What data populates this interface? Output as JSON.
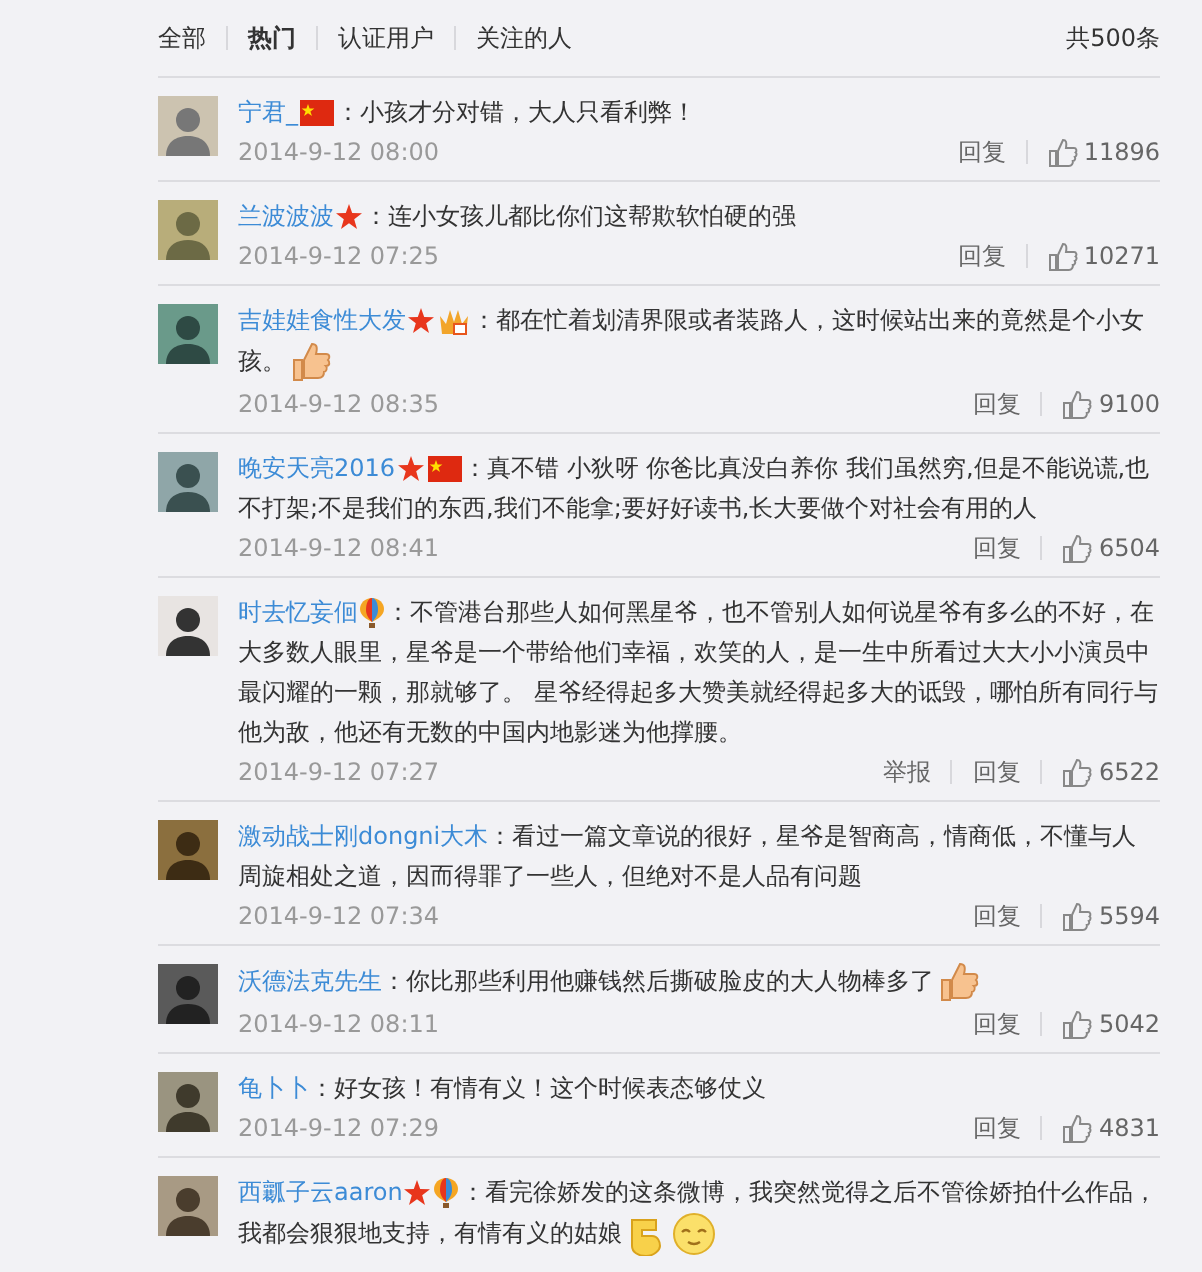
{
  "tabs": [
    {
      "label": "全部",
      "selected": false
    },
    {
      "label": "热门",
      "selected": true
    },
    {
      "label": "认证用户",
      "selected": false
    },
    {
      "label": "关注的人",
      "selected": false
    }
  ],
  "total": "共500条",
  "comments": [
    {
      "user": "宁君_",
      "badges": [
        {
          "kind": "flag"
        }
      ],
      "text": "：小孩才分对错，大人只看利弊！",
      "time": "2014-9-12 08:00",
      "actions": [
        "回复"
      ],
      "likes": "11896"
    },
    {
      "user": "兰波波波",
      "badges": [
        {
          "kind": "star"
        }
      ],
      "text": "：连小女孩儿都比你们这帮欺软怕硬的强",
      "time": "2014-9-12 07:25",
      "actions": [
        "回复"
      ],
      "likes": "10271"
    },
    {
      "user": "吉娃娃食性大发",
      "badges": [
        {
          "kind": "star"
        },
        {
          "kind": "crown"
        }
      ],
      "text": "：都在忙着划清界限或者装路人，这时候站出来的竟然是个小女孩。",
      "emojis": [
        {
          "kind": "thumbs-up"
        }
      ],
      "time": "2014-9-12 08:35",
      "actions": [
        "回复"
      ],
      "likes": "9100"
    },
    {
      "user": "晚安天亮2016",
      "badges": [
        {
          "kind": "star"
        },
        {
          "kind": "flag"
        }
      ],
      "text": "：真不错 小狄呀 你爸比真没白养你 我们虽然穷,但是不能说谎,也不打架;不是我们的东西,我们不能拿;要好好读书,长大要做个对社会有用的人",
      "time": "2014-9-12 08:41",
      "actions": [
        "回复"
      ],
      "likes": "6504"
    },
    {
      "user": "时去忆妄佪",
      "badges": [
        {
          "kind": "balloon"
        }
      ],
      "text": "：不管港台那些人如何黑星爷，也不管别人如何说星爷有多么的不好，在大多数人眼里，星爷是一个带给他们幸福，欢笑的人，是一生中所看过大大小小演员中最闪耀的一颗，那就够了。 星爷经得起多大赞美就经得起多大的诋毁，哪怕所有同行与他为敌，他还有无数的中国内地影迷为他撑腰。",
      "time": "2014-9-12 07:27",
      "actions": [
        "举报",
        "回复"
      ],
      "likes": "6522"
    },
    {
      "user": "激动战士刚dongni大木",
      "text": "：看过一篇文章说的很好，星爷是智商高，情商低，不懂与人周旋相处之道，因而得罪了一些人，但绝对不是人品有问题",
      "time": "2014-9-12 07:34",
      "actions": [
        "回复"
      ],
      "likes": "5594"
    },
    {
      "user": "沃德法克先生",
      "text": "：你比那些利用他赚钱然后撕破脸皮的大人物棒多了",
      "emojis": [
        {
          "kind": "thumbs-up"
        }
      ],
      "time": "2014-9-12 08:11",
      "actions": [
        "回复"
      ],
      "likes": "5042"
    },
    {
      "user": "龟卜卜",
      "text": "：好女孩！有情有义！这个时候表态够仗义",
      "time": "2014-9-12 07:29",
      "actions": [
        "回复"
      ],
      "likes": "4831"
    },
    {
      "user": "西瓤子云aaron",
      "badges": [
        {
          "kind": "star"
        },
        {
          "kind": "balloon"
        }
      ],
      "text": "：看完徐娇发的这条微博，我突然觉得之后不管徐娇拍什么作品，我都会狠狠地支持，有情有义的姑娘",
      "emojis": [
        {
          "kind": "sticker"
        },
        {
          "kind": "smiley"
        }
      ]
    }
  ]
}
